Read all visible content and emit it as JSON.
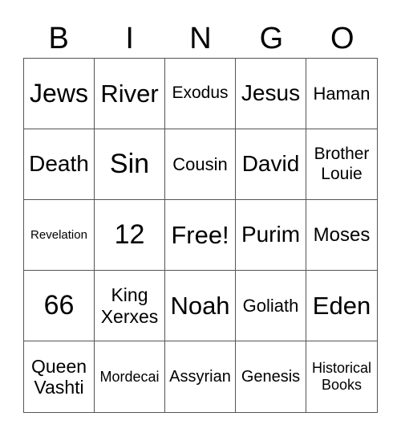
{
  "header": [
    "B",
    "I",
    "N",
    "G",
    "O"
  ],
  "cells": [
    "Jews",
    "River",
    "Exodus",
    "Jesus",
    "Haman",
    "Death",
    "Sin",
    "Cousin",
    "David",
    "Brother\nLouie",
    "Revelation",
    "12",
    "Free!",
    "Purim",
    "Moses",
    "66",
    "King\nXerxes",
    "Noah",
    "Goliath",
    "Eden",
    "Queen\nVashti",
    "Mordecai",
    "Assyrian",
    "Genesis",
    "Historical\nBooks"
  ]
}
